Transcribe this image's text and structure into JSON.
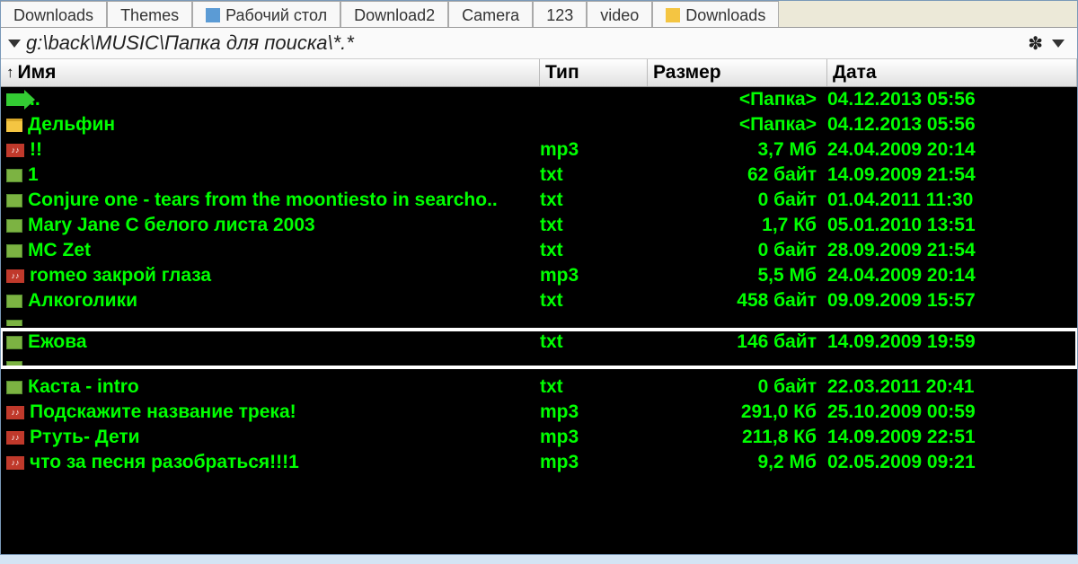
{
  "tabs": [
    "Downloads",
    "Themes",
    "Рабочий стол",
    "Download2",
    "Camera",
    "123",
    "video",
    "Downloads"
  ],
  "path": "g:\\back\\MUSIC\\Папка для поиска\\*.*",
  "columns": {
    "name": "Имя",
    "type": "Тип",
    "size": "Размер",
    "date": "Дата"
  },
  "rows": [
    {
      "icon": "up",
      "name": "..",
      "type": "",
      "size": "<Папка>",
      "date": "04.12.2013 05:56"
    },
    {
      "icon": "folder",
      "name": "Дельфин",
      "type": "",
      "size": "<Папка>",
      "date": "04.12.2013 05:56"
    },
    {
      "icon": "mp3",
      "name": "!!",
      "type": "mp3",
      "size": "3,7 Мб",
      "date": "24.04.2009 20:14"
    },
    {
      "icon": "txt",
      "name": "1",
      "type": "txt",
      "size": "62 байт",
      "date": "14.09.2009 21:54"
    },
    {
      "icon": "txt",
      "name": "Conjure one - tears from the moontiesto in searcho..",
      "type": "txt",
      "size": "0 байт",
      "date": "01.04.2011 11:30"
    },
    {
      "icon": "txt",
      "name": "Mary Jane С белого листа 2003",
      "type": "txt",
      "size": "1,7 Кб",
      "date": "05.01.2010 13:51"
    },
    {
      "icon": "txt",
      "name": "MC Zet",
      "type": "txt",
      "size": "0 байт",
      "date": "28.09.2009 21:54"
    },
    {
      "icon": "mp3",
      "name": "romeo закрой глаза",
      "type": "mp3",
      "size": "5,5 Мб",
      "date": "24.04.2009 20:14"
    },
    {
      "icon": "txt",
      "name": "Алкоголики",
      "type": "txt",
      "size": "458 байт",
      "date": "09.09.2009 15:57"
    }
  ],
  "highlight": {
    "icon": "txt",
    "name": "Ежова",
    "type": "txt",
    "size": "146 байт",
    "date": "14.09.2009 19:59"
  },
  "rows2": [
    {
      "icon": "txt",
      "name": "Каста - intro",
      "type": "txt",
      "size": "0 байт",
      "date": "22.03.2011 20:41"
    },
    {
      "icon": "mp3",
      "name": "Подскажите название трека!",
      "type": "mp3",
      "size": "291,0 Кб",
      "date": "25.10.2009 00:59"
    },
    {
      "icon": "mp3",
      "name": "Ртуть- Дети",
      "type": "mp3",
      "size": "211,8 Кб",
      "date": "14.09.2009 22:51"
    },
    {
      "icon": "mp3",
      "name": "что за песня разобраться!!!1",
      "type": "mp3",
      "size": "9,2 Мб",
      "date": "02.05.2009 09:21"
    }
  ]
}
